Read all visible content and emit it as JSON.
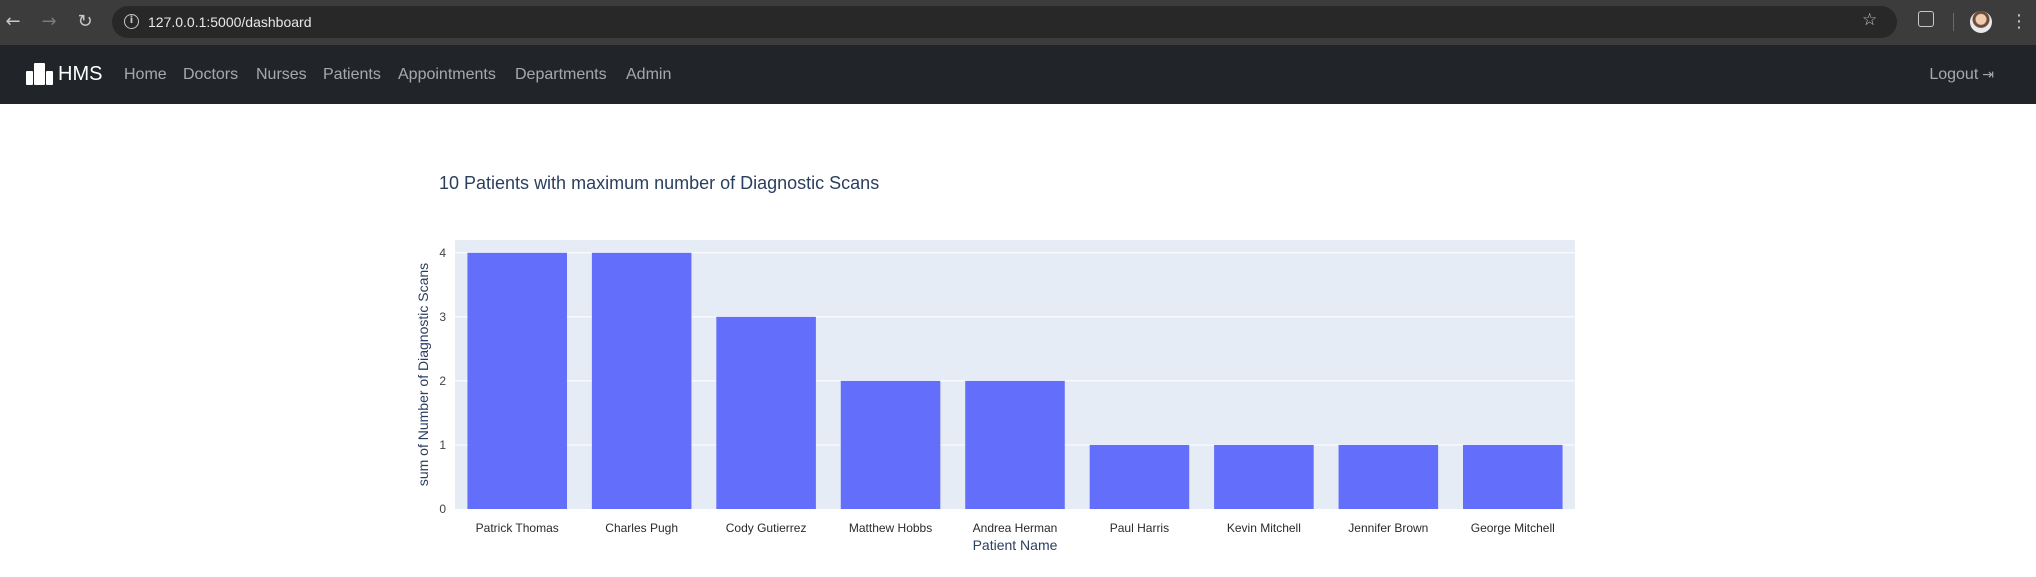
{
  "browser": {
    "url": "127.0.0.1:5000/dashboard",
    "icons": {
      "back": "arrow-left-icon",
      "forward": "arrow-right-icon",
      "reload": "reload-icon",
      "info": "info-icon",
      "bookmark": "star-icon",
      "extensions": "puzzle-icon",
      "profile": "avatar",
      "menu": "kebab-menu-icon"
    }
  },
  "navbar": {
    "brand": "HMS",
    "links": [
      "Home",
      "Doctors",
      "Nurses",
      "Patients",
      "Appointments",
      "Departments",
      "Admin"
    ],
    "logout": "Logout"
  },
  "chart_data": {
    "type": "bar",
    "title": "10 Patients with maximum number of Diagnostic Scans",
    "xlabel": "Patient Name",
    "ylabel": "sum of Number of Diagnostic Scans",
    "categories": [
      "Patrick Thomas",
      "Charles Pugh",
      "Cody Gutierrez",
      "Matthew Hobbs",
      "Andrea Herman",
      "Paul Harris",
      "Kevin Mitchell",
      "Jennifer Brown",
      "George Mitchell"
    ],
    "values": [
      4,
      4,
      3,
      2,
      2,
      1,
      1,
      1,
      1
    ],
    "ylim": [
      0,
      4.2
    ],
    "yticks": [
      "0",
      "1",
      "2",
      "3",
      "4"
    ],
    "grid": true,
    "colors": {
      "bar": "#636efa",
      "plot_bg": "#e5ecf6",
      "text": "#2a3f5f"
    }
  }
}
